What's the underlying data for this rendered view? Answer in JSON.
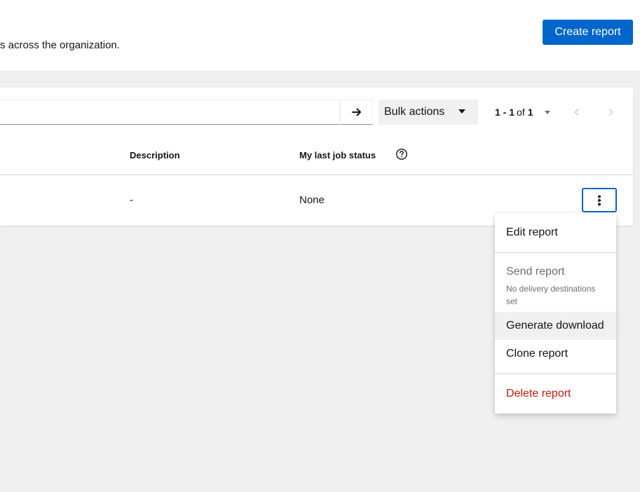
{
  "header": {
    "subtitle": "s across the organization.",
    "create_button": "Create report"
  },
  "toolbar": {
    "search_placeholder": "",
    "search_go_icon": "arrow-right-icon",
    "bulk_actions_label": "Bulk actions",
    "pagination": {
      "range": "1 - 1",
      "of_label": "of",
      "total": "1"
    },
    "prev_icon": "angle-left-icon",
    "next_icon": "angle-right-icon"
  },
  "table": {
    "columns": [
      "Description",
      "My last job status"
    ],
    "help_icon": "help-circle-icon",
    "rows": [
      {
        "description": "-",
        "status": "None"
      }
    ]
  },
  "kebab_menu": {
    "items": [
      {
        "label": "Edit report"
      },
      {
        "label": "Send report",
        "description": "No delivery destinations set",
        "disabled": true
      },
      {
        "label": "Generate download"
      },
      {
        "label": "Clone report"
      },
      {
        "label": "Delete report"
      }
    ]
  },
  "colors": {
    "primary": "#0066cc",
    "danger": "#c9190b",
    "background": "#f0f0f0",
    "hover": "#f0f0f0"
  }
}
